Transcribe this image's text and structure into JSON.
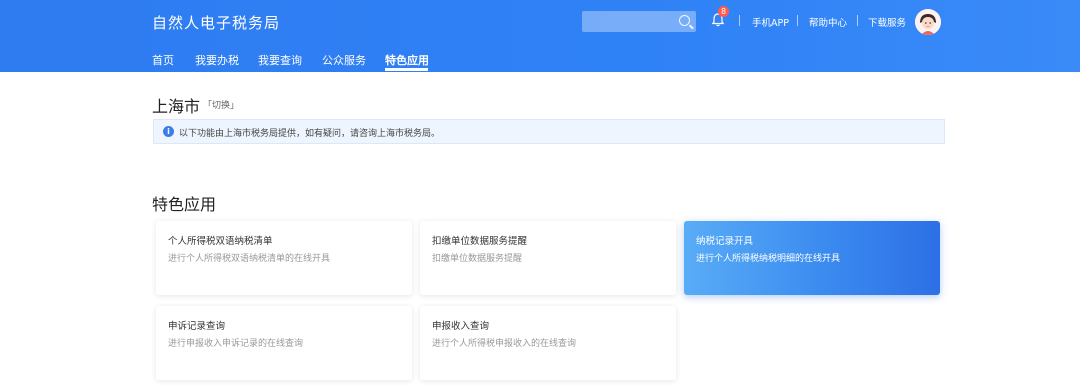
{
  "header": {
    "logo": "自然人电子税务局",
    "notification_count": "8",
    "links": {
      "app": "手机APP",
      "help": "帮助中心",
      "download": "下载服务"
    }
  },
  "nav": {
    "items": [
      "首页",
      "我要办税",
      "我要查询",
      "公众服务",
      "特色应用"
    ],
    "active_index": 4
  },
  "region": {
    "city": "上海市",
    "switch_label": "「切换」",
    "notice": "以下功能由上海市税务局提供，如有疑问，请咨询上海市税务局。"
  },
  "section": {
    "title": "特色应用",
    "cards": [
      {
        "title": "个人所得税双语纳税清单",
        "desc": "进行个人所得税双语纳税清单的在线开具"
      },
      {
        "title": "扣缴单位数据服务提醒",
        "desc": "扣缴单位数据服务提醒"
      },
      {
        "title": "纳税记录开具",
        "desc": "进行个人所得税纳税明细的在线开具"
      },
      {
        "title": "申诉记录查询",
        "desc": "进行申报收入申诉记录的在线查询"
      },
      {
        "title": "申报收入查询",
        "desc": "进行个人所得税申报收入的在线查询"
      }
    ]
  },
  "colors": {
    "header_blue": "#2f7bf0",
    "highlight_card": "#3b8bf0",
    "badge_red": "#ff5a4e",
    "notice_bg": "#eef5fe"
  },
  "icons": [
    "search-icon",
    "bell-icon",
    "avatar",
    "info-icon"
  ]
}
